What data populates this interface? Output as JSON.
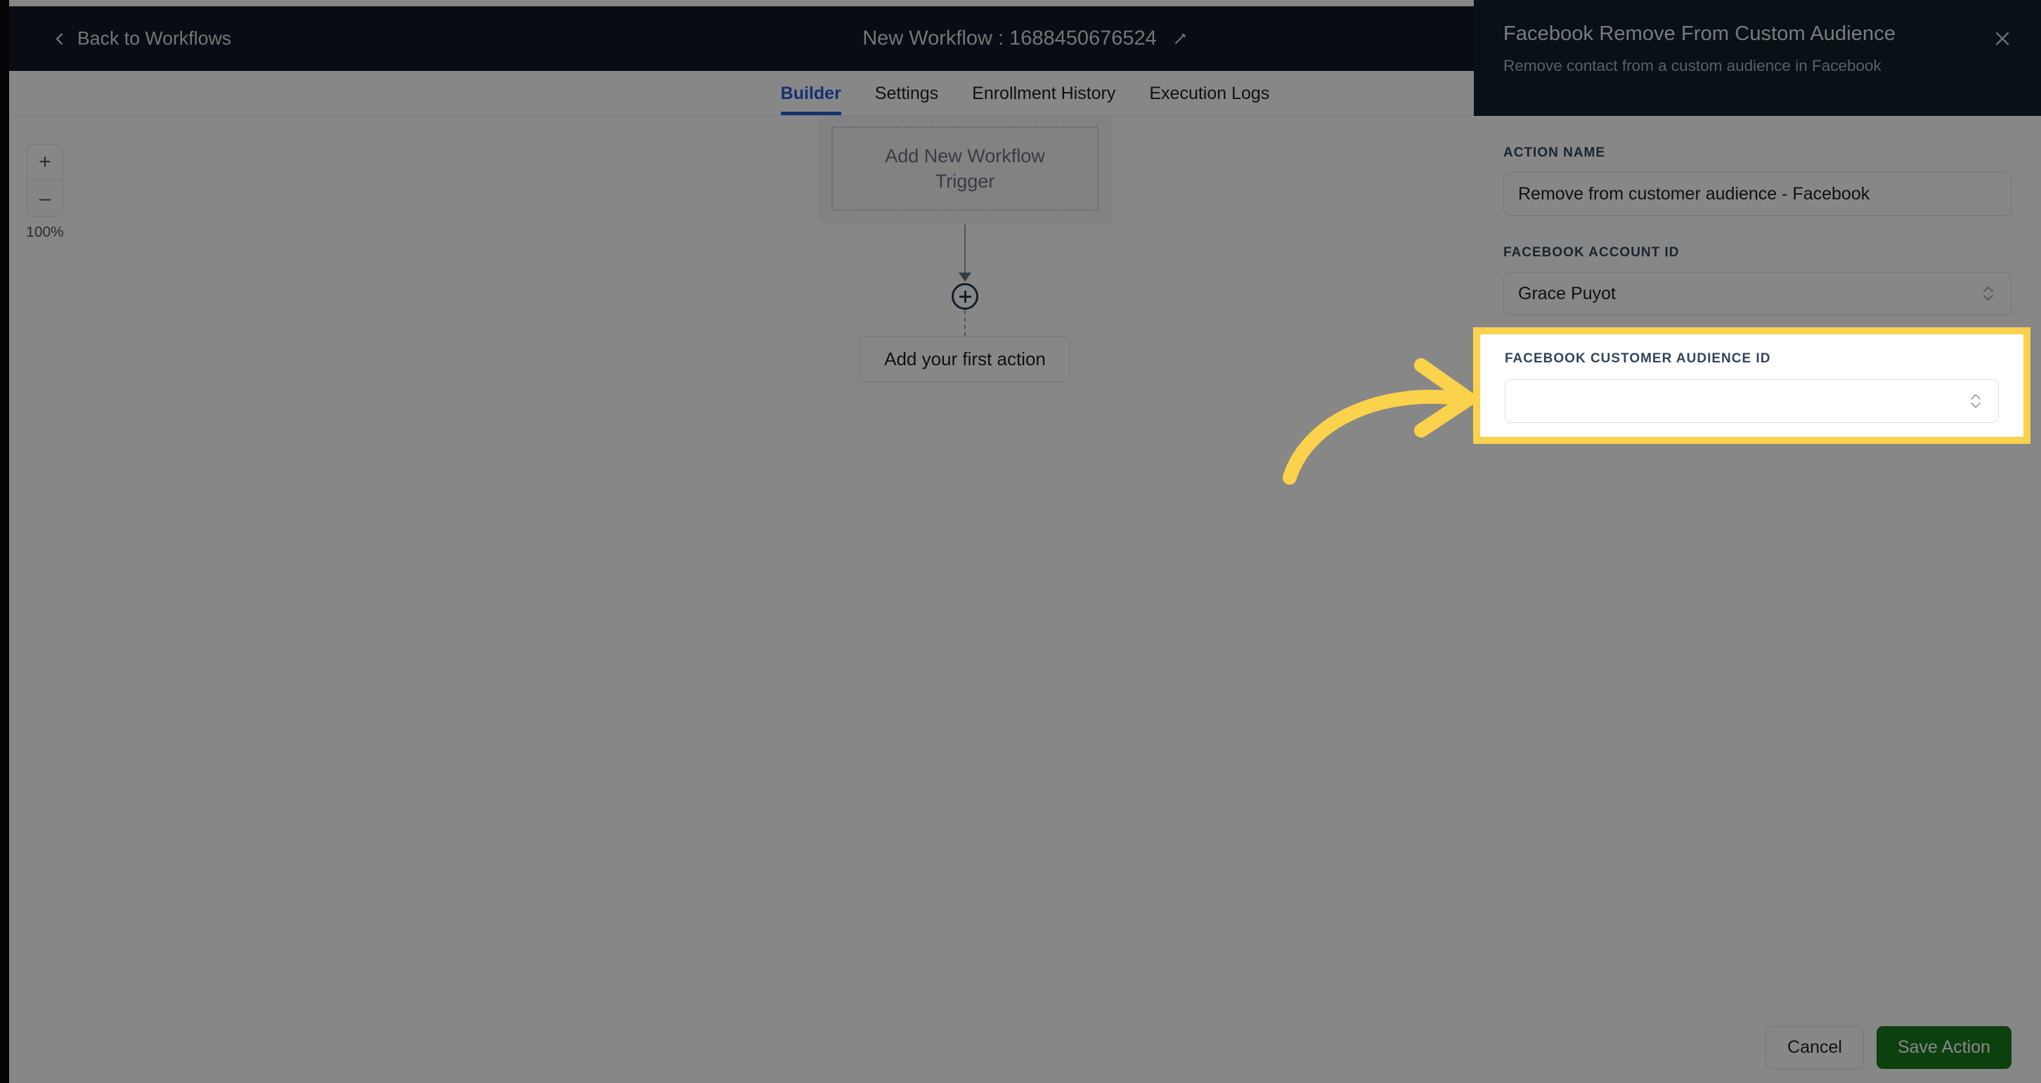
{
  "topbar": {
    "back_label": "Back to Workflows",
    "back_icon": "chevron-left-icon",
    "workflow_title": "New Workflow : 1688450676524",
    "edit_icon": "pencil-icon"
  },
  "tabs": [
    {
      "label": "Builder",
      "active": true
    },
    {
      "label": "Settings",
      "active": false
    },
    {
      "label": "Enrollment History",
      "active": false
    },
    {
      "label": "Execution Logs",
      "active": false
    }
  ],
  "canvas": {
    "zoom": {
      "plus_label": "+",
      "minus_label": "–",
      "level": "100%"
    },
    "trigger_card_text": "Add New Workflow Trigger",
    "add_node_icon": "plus-circle-icon",
    "first_action_label": "Add your first action"
  },
  "panel": {
    "title": "Facebook Remove From Custom Audience",
    "subtitle": "Remove contact from a custom audience in Facebook",
    "close_icon": "close-icon",
    "fields": [
      {
        "label": "ACTION NAME",
        "type": "text",
        "value": "Remove from customer audience - Facebook",
        "placeholder": ""
      },
      {
        "label": "FACEBOOK ACCOUNT ID",
        "type": "select",
        "value": "Grace Puyot",
        "stepper_icon": "stepper-updown-icon"
      }
    ],
    "highlighted_field": {
      "label": "FACEBOOK CUSTOMER AUDIENCE ID",
      "type": "select",
      "value": "",
      "placeholder": "",
      "stepper_icon": "stepper-updown-icon"
    },
    "footer": {
      "cancel_label": "Cancel",
      "save_label": "Save Action"
    }
  },
  "annotation": {
    "arrow_icon": "curved-arrow-right-icon",
    "highlight_color": "#fbd24c",
    "arrow_color": "#fbd24c"
  },
  "colors": {
    "topbar_bg": "#111a24",
    "panel_header_bg": "#0e212b",
    "accent_tab": "#2a5bd7",
    "save_green": "#1a7a1e",
    "highlight_yellow": "#fbd24c"
  }
}
